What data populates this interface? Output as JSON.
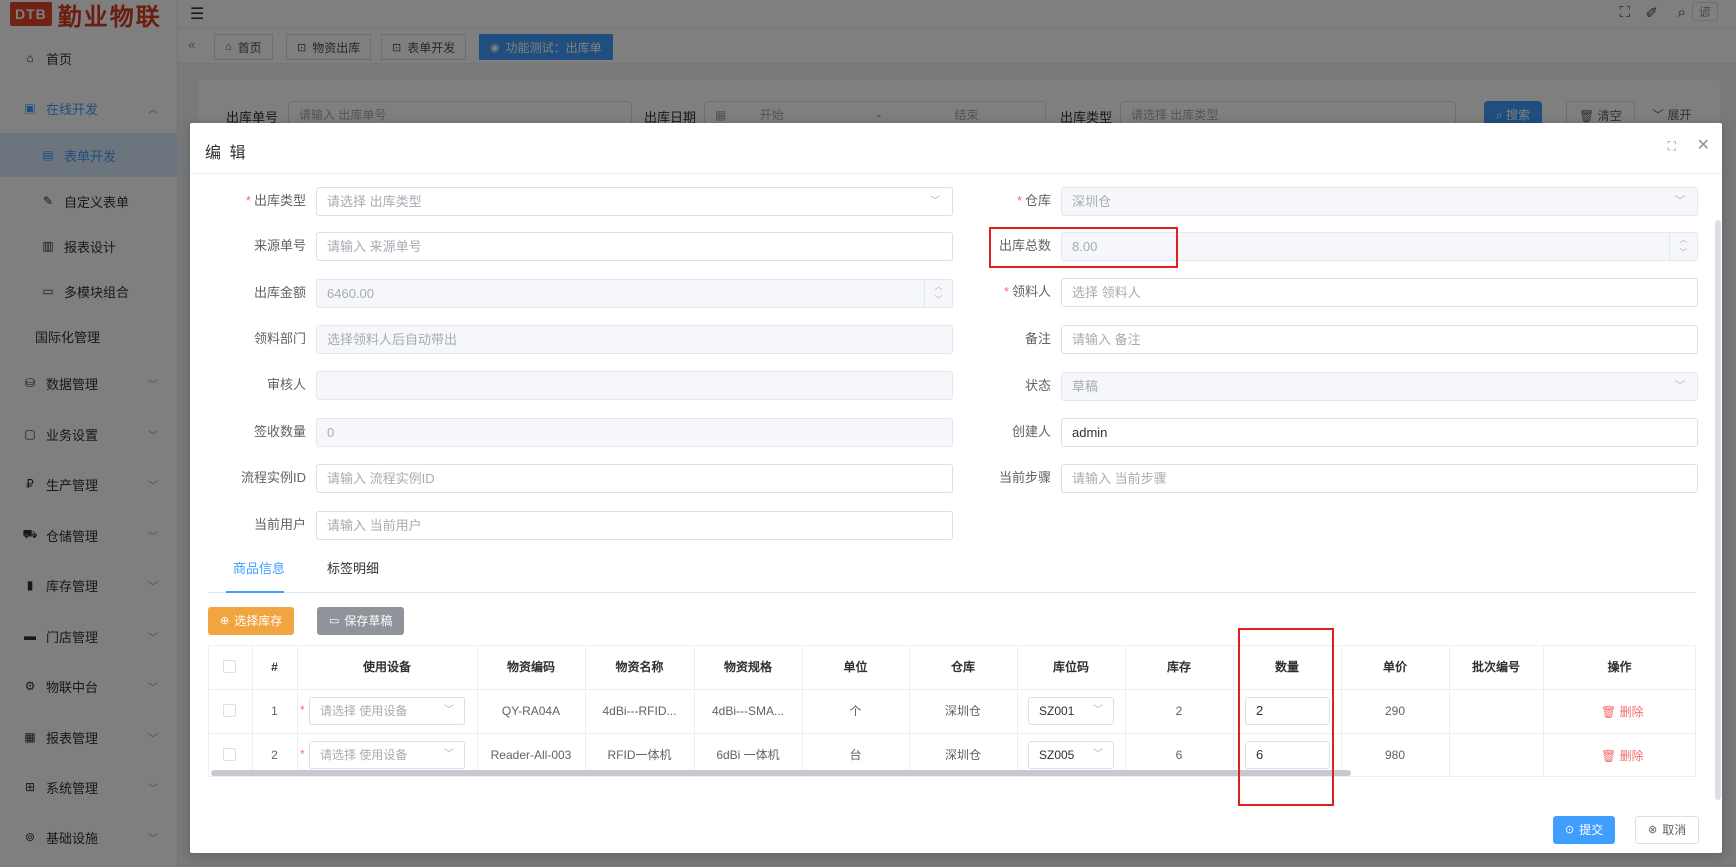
{
  "logo": {
    "badge": "DTB",
    "name": "勤业物联"
  },
  "sidebar": {
    "items": [
      {
        "label": "首页",
        "icon": "home-icon"
      },
      {
        "label": "在线开发",
        "icon": "dev-icon"
      },
      {
        "label": "表单开发",
        "icon": "form-icon"
      },
      {
        "label": "自定义表单",
        "icon": "edit-icon"
      },
      {
        "label": "报表设计",
        "icon": "report-icon"
      },
      {
        "label": "多模块组合",
        "icon": "module-icon"
      },
      {
        "label": "国际化管理",
        "icon": ""
      },
      {
        "label": "数据管理",
        "icon": "database-icon"
      },
      {
        "label": "业务设置",
        "icon": "business-icon"
      },
      {
        "label": "生产管理",
        "icon": "production-icon"
      },
      {
        "label": "仓储管理",
        "icon": "truck-icon"
      },
      {
        "label": "库存管理",
        "icon": "chart-icon"
      },
      {
        "label": "门店管理",
        "icon": "store-icon"
      },
      {
        "label": "物联中台",
        "icon": "gear-icon"
      },
      {
        "label": "报表管理",
        "icon": "report-mgmt-icon"
      },
      {
        "label": "系统管理",
        "icon": "grid-icon"
      },
      {
        "label": "基础设施",
        "icon": "infra-icon"
      }
    ]
  },
  "topbar": {
    "hamburger": "☰",
    "icons": [
      "fullscreen-icon",
      "broom-icon",
      "search-icon"
    ],
    "lang": "谚"
  },
  "tabs": [
    {
      "label": "首页",
      "icon": "home-icon"
    },
    {
      "label": "物资出库",
      "icon": "outbound-icon"
    },
    {
      "label": "表单开发",
      "icon": "form-icon"
    },
    {
      "label": "功能测试：出库单",
      "icon": "eye-icon"
    }
  ],
  "filter": {
    "order_label": "出库单号",
    "order_placeholder": "请输入 出库单号",
    "date_label": "出库日期",
    "date_start": "开始",
    "date_sep": "-",
    "date_end": "结束",
    "type_label": "出库类型",
    "type_placeholder": "请选择 出库类型",
    "search": "搜索",
    "clear": "清空",
    "expand": "展开"
  },
  "dialog": {
    "title": "编 辑",
    "left_fields": [
      {
        "label": "出库类型",
        "required": "*",
        "value": "请选择 出库类型"
      },
      {
        "label": "来源单号",
        "required": "",
        "value": "请输入 来源单号"
      },
      {
        "label": "出库金额",
        "required": "",
        "value": "6460.00"
      },
      {
        "label": "领料部门",
        "required": "",
        "value": "选择领料人后自动带出"
      },
      {
        "label": "审核人",
        "required": "",
        "value": ""
      },
      {
        "label": "签收数量",
        "required": "",
        "value": "0"
      },
      {
        "label": "流程实例ID",
        "required": "",
        "value": "请输入 流程实例ID"
      },
      {
        "label": "当前用户",
        "required": "",
        "value": "请输入 当前用户"
      }
    ],
    "right_fields": [
      {
        "label": "仓库",
        "required": "*",
        "value": "深圳仓"
      },
      {
        "label": "出库总数",
        "required": "",
        "value": "8.00"
      },
      {
        "label": "领料人",
        "required": "*",
        "value": "选择 领料人"
      },
      {
        "label": "备注",
        "required": "",
        "value": "请输入 备注"
      },
      {
        "label": "状态",
        "required": "",
        "value": "草稿"
      },
      {
        "label": "创建人",
        "required": "",
        "value": "admin"
      },
      {
        "label": "当前步骤",
        "required": "",
        "value": "请输入 当前步骤"
      }
    ],
    "subtabs": [
      "商品信息",
      "标签明细"
    ],
    "select_stock": "选择库存",
    "save_draft": "保存草稿",
    "table": {
      "headers": [
        "#",
        "使用设备",
        "物资编码",
        "物资名称",
        "物资规格",
        "单位",
        "仓库",
        "库位码",
        "库存",
        "数量",
        "单价",
        "批次编号",
        "操作"
      ],
      "rows": [
        {
          "idx": "1",
          "device": "请选择 使用设备",
          "code": "QY-RA04A",
          "name": "4dBi---RFID...",
          "spec": "4dBi---SMA...",
          "unit": "个",
          "warehouse": "深圳仓",
          "location": "SZ001",
          "stock": "2",
          "qty": "2",
          "price": "290",
          "batch": "",
          "action": "删除"
        },
        {
          "idx": "2",
          "device": "请选择 使用设备",
          "code": "Reader-All-003",
          "name": "RFID一体机",
          "spec": "6dBi 一体机",
          "unit": "台",
          "warehouse": "深圳仓",
          "location": "SZ005",
          "stock": "6",
          "qty": "6",
          "price": "980",
          "batch": "",
          "action": "删除"
        }
      ]
    },
    "submit": "提交",
    "cancel": "取消"
  },
  "colors": {
    "primary": "#409eff",
    "warning": "#f0a540",
    "danger": "#f56c6c",
    "highlight": "#e02020"
  }
}
